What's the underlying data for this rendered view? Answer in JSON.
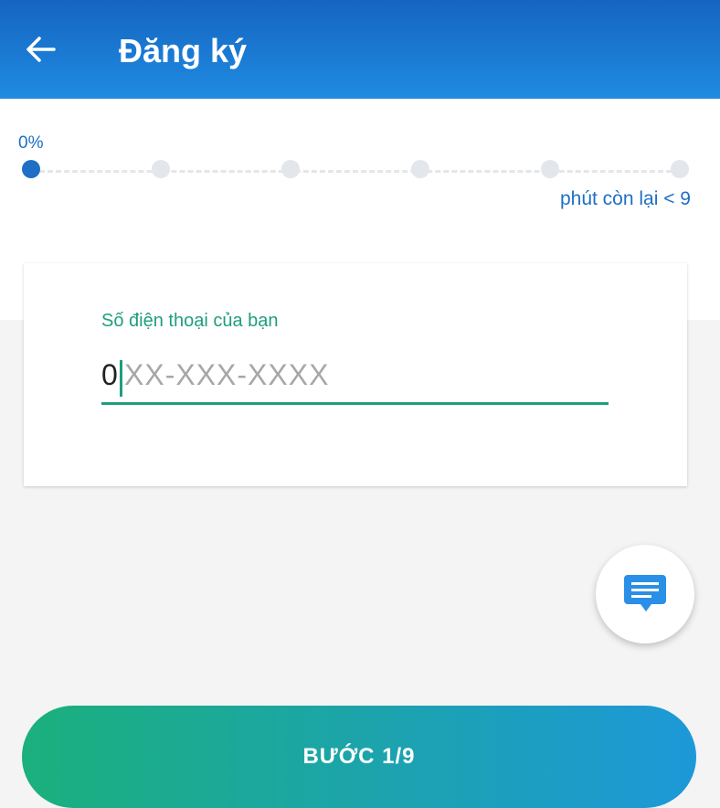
{
  "header": {
    "title": "Đăng ký",
    "back_icon": "arrow-left-icon",
    "background": "#1a78d4"
  },
  "progress": {
    "percent_label": "0%",
    "fraction_complete": 0,
    "steps_total": 6,
    "current_step_index": 0,
    "time_left": "phút còn lại < 9",
    "active_color": "#1e6fc5"
  },
  "form": {
    "phone_label": "Số điện thoại của bạn",
    "phone_value": "0",
    "phone_placeholder": "XX-XXX-XXXX",
    "accent_color": "#1e9e7c"
  },
  "chat_fab": {
    "icon": "chat-message-icon"
  },
  "footer": {
    "step_button_label": "BƯỚC 1/9"
  }
}
